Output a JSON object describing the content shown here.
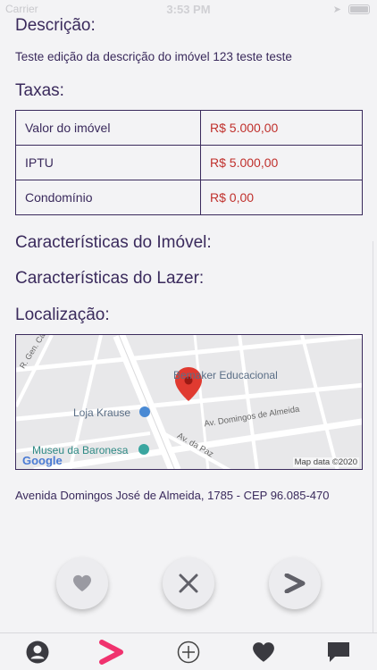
{
  "status_bar": {
    "carrier": "Carrier",
    "time": "3:53 PM"
  },
  "description": {
    "title": "Descrição:",
    "text": "Teste edição da descrição do imóvel 123 teste teste"
  },
  "fees": {
    "title": "Taxas:",
    "rows": [
      {
        "label": "Valor do imóvel",
        "value": "R$ 5.000,00"
      },
      {
        "label": "IPTU",
        "value": "R$ 5.000,00"
      },
      {
        "label": "Condomínio",
        "value": "R$ 0,00"
      }
    ]
  },
  "features": {
    "title": "Características do Imóvel:"
  },
  "leisure": {
    "title": "Características do Lazer:"
  },
  "location": {
    "title": "Localização:",
    "map": {
      "places": [
        "Bemaker Educacional",
        "Loja Krause",
        "Museu da Baronesa"
      ],
      "streets": [
        "R. Gen. Câmara",
        "Av. Domingos de Almeida",
        "Av. da Paz"
      ],
      "logo": "Google",
      "attribution": "Map data ©2020"
    },
    "address": "Avenida Domingos José de Almeida, 1785 - CEP 96.085-470"
  },
  "colors": {
    "accent": "#f0326e",
    "text": "#3a2a5c",
    "price": "#c0302c"
  },
  "actions": [
    {
      "name": "like",
      "icon": "heart-icon"
    },
    {
      "name": "dismiss",
      "icon": "close-icon"
    },
    {
      "name": "next",
      "icon": "chevron-right-icon"
    }
  ],
  "tabs": [
    {
      "name": "profile",
      "icon": "user-icon"
    },
    {
      "name": "discover",
      "icon": "chevron-icon",
      "active": true
    },
    {
      "name": "add",
      "icon": "plus-circle-icon"
    },
    {
      "name": "favorites",
      "icon": "heart-icon"
    },
    {
      "name": "messages",
      "icon": "chat-icon"
    }
  ]
}
